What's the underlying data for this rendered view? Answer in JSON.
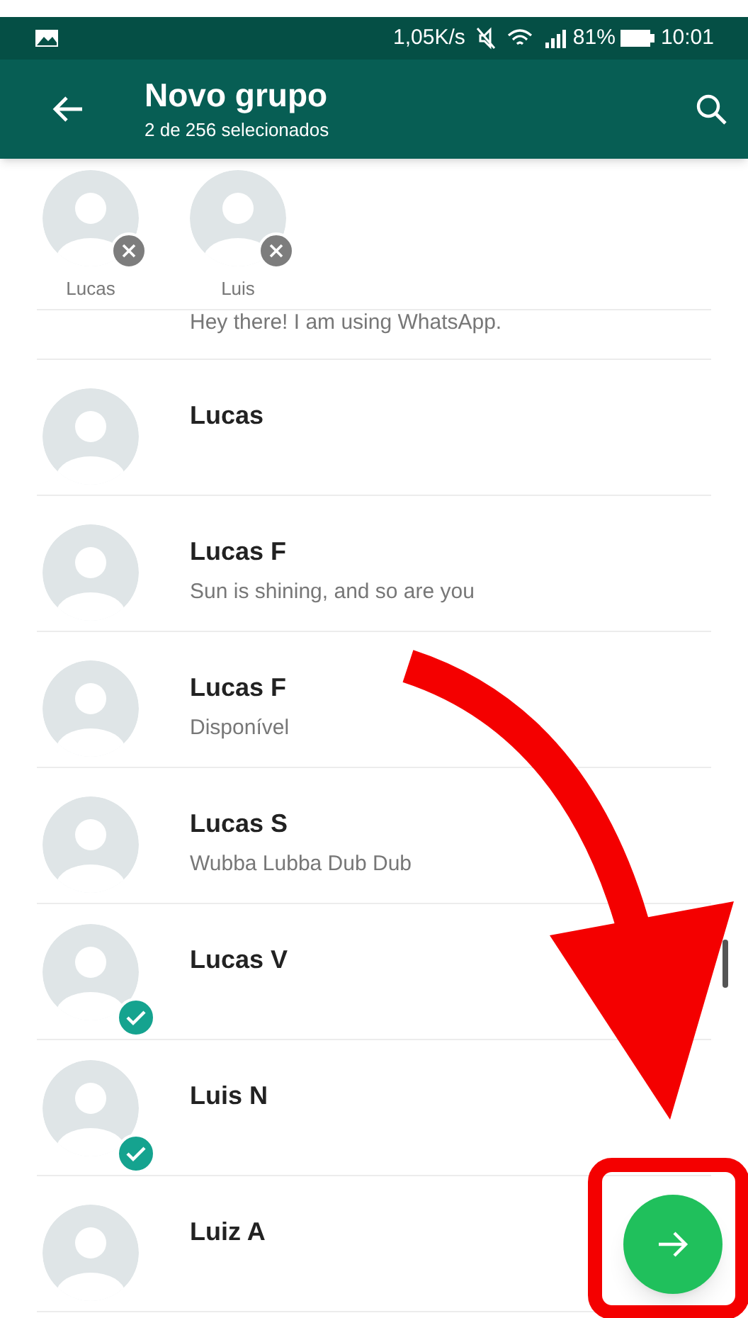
{
  "status_bar": {
    "speed": "1,05K/s",
    "battery": "81%",
    "time": "10:01"
  },
  "app_bar": {
    "title": "Novo grupo",
    "subtitle": "2 de 256 selecionados"
  },
  "selected_contacts": [
    {
      "name": "Lucas"
    },
    {
      "name": "Luis"
    }
  ],
  "partial_contact": {
    "status": "Hey there! I am using WhatsApp."
  },
  "contacts": [
    {
      "name": "Lucas",
      "selected": false
    },
    {
      "name": "Lucas F",
      "status": "Sun is shining, and so are you",
      "selected": false
    },
    {
      "name": "Lucas F",
      "status": "Disponível",
      "selected": false
    },
    {
      "name": "Lucas S",
      "status": "Wubba Lubba Dub Dub",
      "selected": false
    },
    {
      "name": "Lucas V",
      "selected": true
    },
    {
      "name": "Luis N",
      "selected": true
    },
    {
      "name": "Luiz A",
      "selected": false
    }
  ]
}
